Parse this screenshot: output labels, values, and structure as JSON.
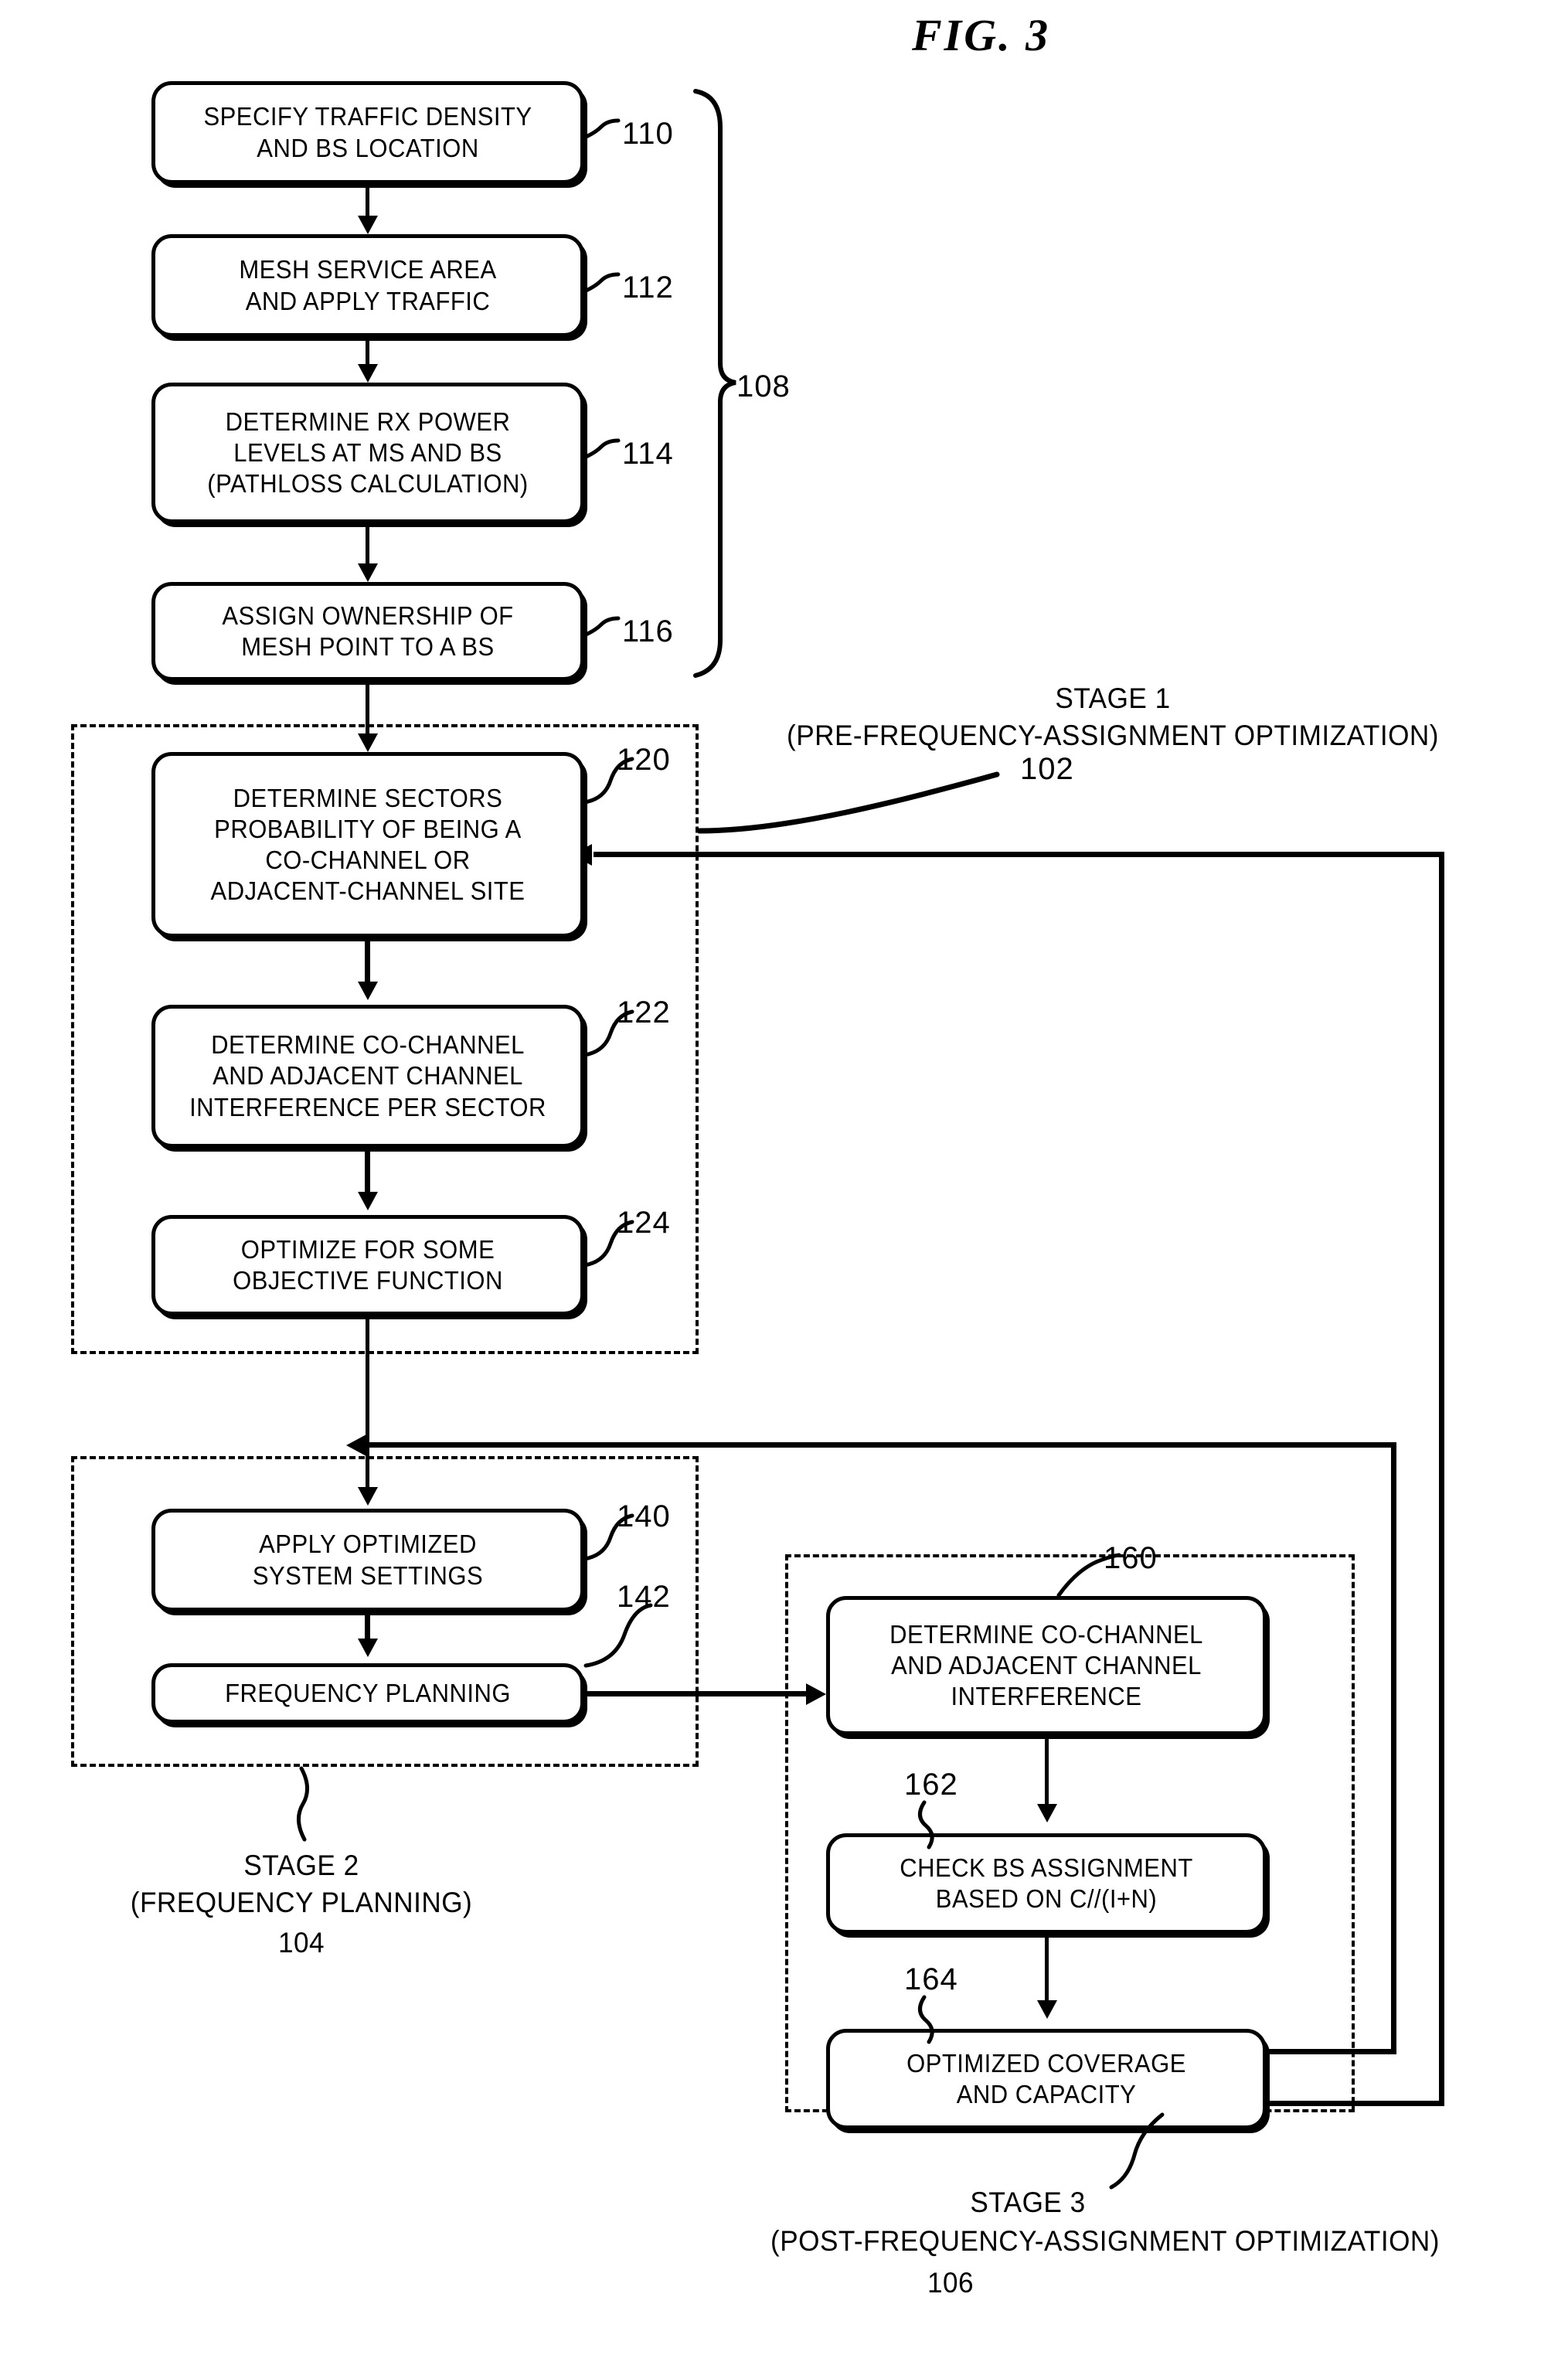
{
  "figure": {
    "title": "FIG.  3"
  },
  "groups": {
    "g108": {
      "ref": "108"
    }
  },
  "nodes": [
    {
      "id": "n110",
      "ref": "110",
      "text": "SPECIFY TRAFFIC DENSITY\nAND BS LOCATION"
    },
    {
      "id": "n112",
      "ref": "112",
      "text": "MESH SERVICE AREA\nAND APPLY TRAFFIC"
    },
    {
      "id": "n114",
      "ref": "114",
      "text": "DETERMINE RX POWER\nLEVELS AT MS AND BS\n(PATHLOSS CALCULATION)"
    },
    {
      "id": "n116",
      "ref": "116",
      "text": "ASSIGN OWNERSHIP OF\nMESH POINT TO A BS"
    },
    {
      "id": "n120",
      "ref": "120",
      "text": "DETERMINE SECTORS\nPROBABILITY OF BEING A\nCO-CHANNEL OR\nADJACENT-CHANNEL SITE"
    },
    {
      "id": "n122",
      "ref": "122",
      "text": "DETERMINE CO-CHANNEL\nAND ADJACENT CHANNEL\nINTERFERENCE PER SECTOR"
    },
    {
      "id": "n124",
      "ref": "124",
      "text": "OPTIMIZE FOR SOME\nOBJECTIVE FUNCTION"
    },
    {
      "id": "n140",
      "ref": "140",
      "text": "APPLY OPTIMIZED\nSYSTEM SETTINGS"
    },
    {
      "id": "n142",
      "ref": "142",
      "text": "FREQUENCY PLANNING"
    },
    {
      "id": "n160",
      "ref": "160",
      "text": "DETERMINE CO-CHANNEL\nAND ADJACENT CHANNEL\nINTERFERENCE"
    },
    {
      "id": "n162",
      "ref": "162",
      "text": "CHECK BS ASSIGNMENT\nBASED ON C//(I+N)"
    },
    {
      "id": "n164",
      "ref": "164",
      "text": "OPTIMIZED COVERAGE\nAND CAPACITY"
    }
  ],
  "stages": {
    "stage1": {
      "caption": "STAGE 1\n(PRE-FREQUENCY-ASSIGNMENT OPTIMIZATION)",
      "ref": "102"
    },
    "stage2": {
      "caption": "STAGE 2\n(FREQUENCY PLANNING)",
      "ref": "104"
    },
    "stage3": {
      "caption": "STAGE 3",
      "caption2": "(POST-FREQUENCY-ASSIGNMENT OPTIMIZATION)",
      "ref": "106"
    }
  },
  "colors": {
    "ink": "#000000",
    "paper": "#ffffff"
  }
}
